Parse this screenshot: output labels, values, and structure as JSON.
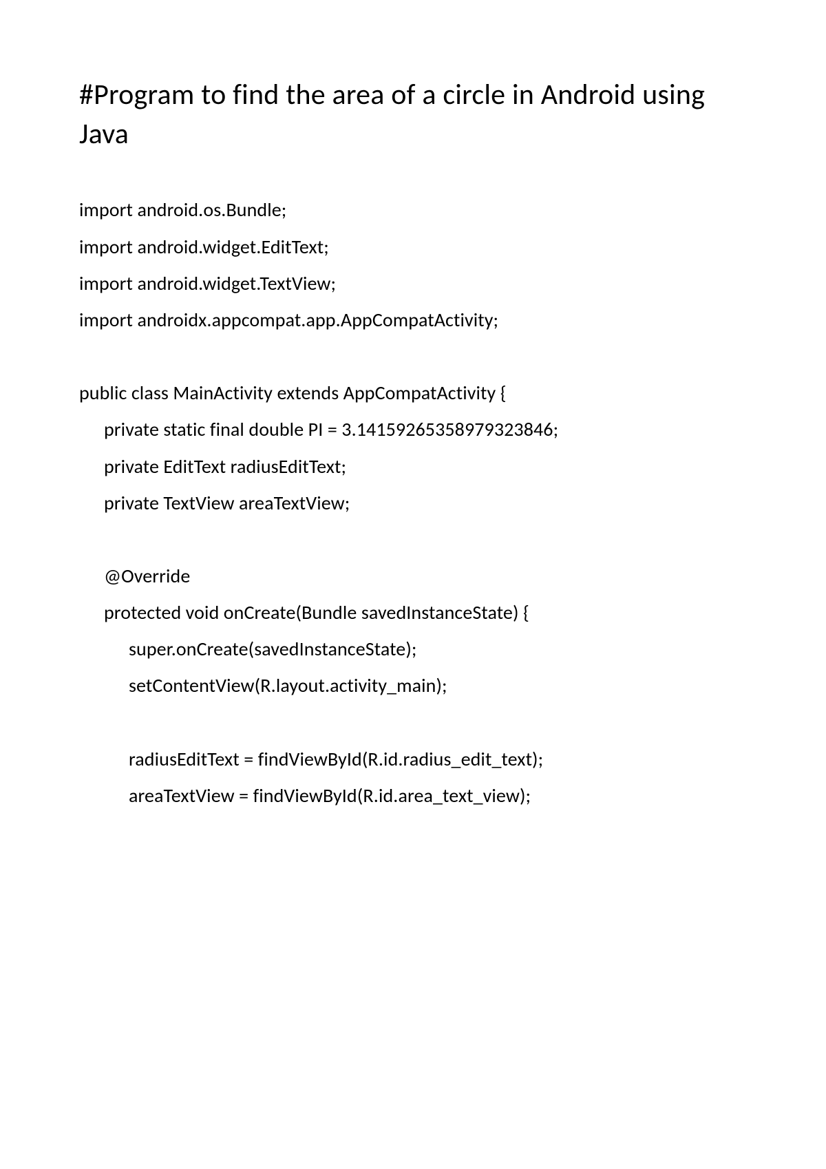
{
  "title": "#Program to find the area of a circle in Android using Java",
  "code": {
    "lines": [
      {
        "text": "import android.os.Bundle;",
        "indent": 0
      },
      {
        "text": "import android.widget.EditText;",
        "indent": 0
      },
      {
        "text": "import android.widget.TextView;",
        "indent": 0
      },
      {
        "text": "import androidx.appcompat.app.AppCompatActivity;",
        "indent": 0
      },
      {
        "blank": true
      },
      {
        "text": "public class MainActivity extends AppCompatActivity {",
        "indent": 0
      },
      {
        "text": "private static final double PI = 3.14159265358979323846;",
        "indent": 1
      },
      {
        "text": "private EditText radiusEditText;",
        "indent": 1
      },
      {
        "text": "private TextView areaTextView;",
        "indent": 1
      },
      {
        "blank": true
      },
      {
        "text": "@Override",
        "indent": 1
      },
      {
        "text": "protected void onCreate(Bundle savedInstanceState) {",
        "indent": 1
      },
      {
        "text": "super.onCreate(savedInstanceState);",
        "indent": 2
      },
      {
        "text": "setContentView(R.layout.activity_main);",
        "indent": 2
      },
      {
        "blank": true
      },
      {
        "text": "radiusEditText = findViewById(R.id.radius_edit_text);",
        "indent": 2
      },
      {
        "text": "areaTextView = findViewById(R.id.area_text_view);",
        "indent": 2
      }
    ]
  }
}
